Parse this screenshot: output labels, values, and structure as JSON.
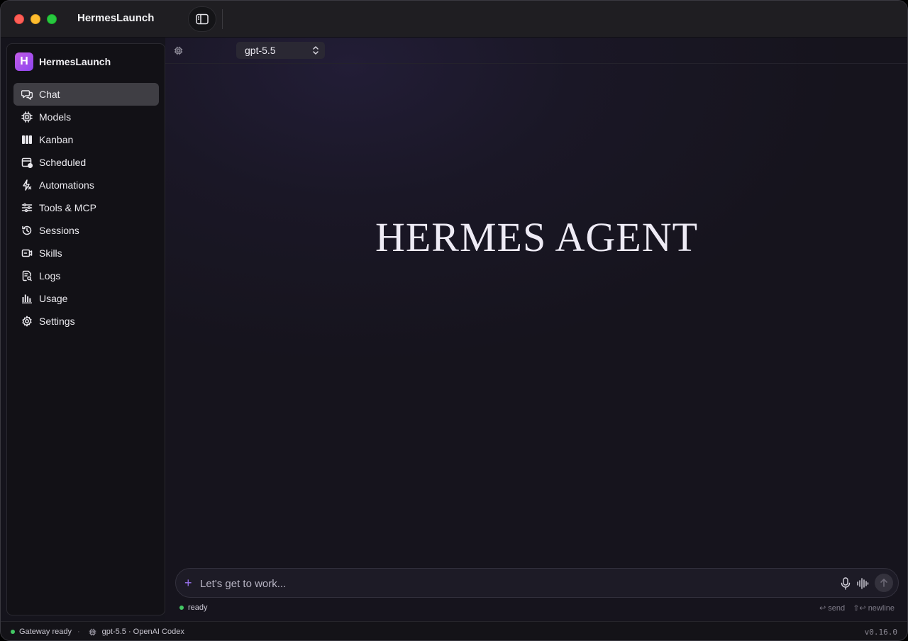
{
  "window": {
    "title": "HermesLaunch"
  },
  "sidebar": {
    "brand_letter": "H",
    "brand_name": "HermesLaunch",
    "items": [
      {
        "label": "Chat",
        "icon": "chat-icon",
        "active": true
      },
      {
        "label": "Models",
        "icon": "chip-icon"
      },
      {
        "label": "Kanban",
        "icon": "kanban-icon"
      },
      {
        "label": "Scheduled",
        "icon": "calendar-clock-icon"
      },
      {
        "label": "Automations",
        "icon": "bolt-icon"
      },
      {
        "label": "Tools & MCP",
        "icon": "sliders-icon"
      },
      {
        "label": "Sessions",
        "icon": "history-icon"
      },
      {
        "label": "Skills",
        "icon": "skill-icon"
      },
      {
        "label": "Logs",
        "icon": "log-icon"
      },
      {
        "label": "Usage",
        "icon": "bar-chart-icon"
      },
      {
        "label": "Settings",
        "icon": "gear-icon"
      }
    ]
  },
  "topbar": {
    "model": "gpt-5.5"
  },
  "hero": {
    "title": "HERMES AGENT"
  },
  "composer": {
    "placeholder": "Let's get to work...",
    "status": "ready",
    "hint_send": "↩ send",
    "hint_newline": "⇧↩ newline"
  },
  "footer": {
    "gateway": "Gateway ready",
    "model_info": "gpt-5.5 · OpenAI Codex",
    "version": "v0.16.0"
  },
  "colors": {
    "accent": "#9a72f0",
    "status_ok": "#43c864",
    "brand_gradient_start": "#c25be6",
    "brand_gradient_end": "#8e45f0"
  }
}
